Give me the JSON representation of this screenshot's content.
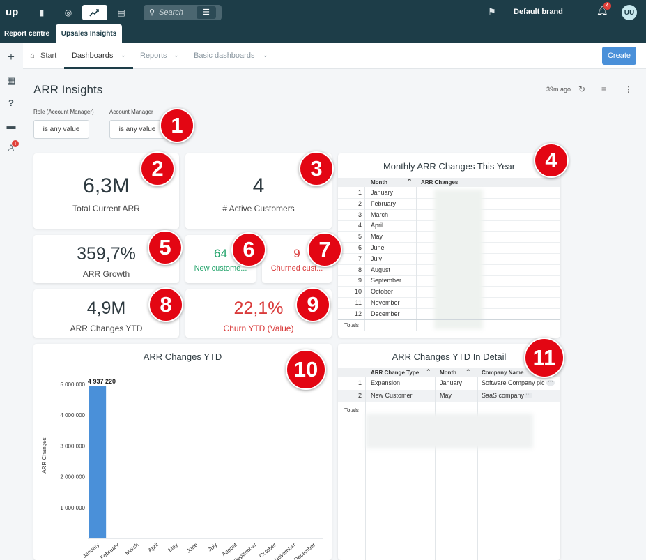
{
  "topbar": {
    "logo": "up",
    "search_placeholder": "Search",
    "brand": "Default brand",
    "notifications_count": "4",
    "avatar_initials": "UU"
  },
  "tabs": {
    "report_centre": "Report centre",
    "upsales_insights": "Upsales Insights"
  },
  "sidebar": {
    "badge": "!"
  },
  "subnav": {
    "start": "Start",
    "dashboards": "Dashboards",
    "reports": "Reports",
    "basic_dashboards": "Basic dashboards",
    "create": "Create"
  },
  "page": {
    "title": "ARR Insights",
    "updated": "39m ago"
  },
  "filters": [
    {
      "label": "Role (Account Manager)",
      "value": "is any value"
    },
    {
      "label": "Account Manager",
      "value": "is any value"
    }
  ],
  "kpis": {
    "total_arr": {
      "value": "6,3M",
      "label": "Total Current ARR"
    },
    "active_customers": {
      "value": "4",
      "label": "# Active Customers"
    },
    "arr_growth": {
      "value": "359,7%",
      "label": "ARR Growth"
    },
    "new_customers": {
      "value": "64",
      "label": "New custome..."
    },
    "churned_customers": {
      "value": "9",
      "label": "Churned cust..."
    },
    "arr_changes_ytd": {
      "value": "4,9M",
      "label": "ARR Changes YTD"
    },
    "churn_ytd": {
      "value": "22,1%",
      "label": "Churn YTD (Value)"
    }
  },
  "monthly_table": {
    "title": "Monthly ARR Changes This Year",
    "col_month": "Month",
    "col_changes": "ARR Changes",
    "rows": [
      {
        "n": "1",
        "month": "January"
      },
      {
        "n": "2",
        "month": "February"
      },
      {
        "n": "3",
        "month": "March"
      },
      {
        "n": "4",
        "month": "April"
      },
      {
        "n": "5",
        "month": "May"
      },
      {
        "n": "6",
        "month": "June"
      },
      {
        "n": "7",
        "month": "July"
      },
      {
        "n": "8",
        "month": "August"
      },
      {
        "n": "9",
        "month": "September"
      },
      {
        "n": "10",
        "month": "October"
      },
      {
        "n": "11",
        "month": "November"
      },
      {
        "n": "12",
        "month": "December"
      }
    ],
    "totals": "Totals"
  },
  "detail_table": {
    "title": "ARR Changes YTD In Detail",
    "cols": [
      "ARR Change Type",
      "Month",
      "Company Name"
    ],
    "rows": [
      {
        "n": "1",
        "type": "Expansion",
        "month": "January",
        "company": "Software Company plc"
      },
      {
        "n": "2",
        "type": "New Customer",
        "month": "May",
        "company": "SaaS company"
      }
    ],
    "totals": "Totals"
  },
  "markers": [
    "1",
    "2",
    "3",
    "4",
    "5",
    "6",
    "7",
    "8",
    "9",
    "10",
    "11"
  ],
  "chart_data": {
    "type": "bar",
    "title": "ARR Changes YTD",
    "ylabel": "ARR Changes",
    "xlabel": "",
    "categories": [
      "January",
      "February",
      "March",
      "April",
      "May",
      "June",
      "July",
      "August",
      "September",
      "October",
      "November",
      "December"
    ],
    "values": [
      4937220,
      0,
      0,
      0,
      0,
      0,
      0,
      0,
      0,
      0,
      0,
      0
    ],
    "data_labels": [
      "4 937 220"
    ],
    "yticks": [
      "1 000 000",
      "2 000 000",
      "3 000 000",
      "4 000 000",
      "5 000 000"
    ],
    "ylim": [
      0,
      5000000
    ],
    "bar_color": "#4a90d9"
  }
}
